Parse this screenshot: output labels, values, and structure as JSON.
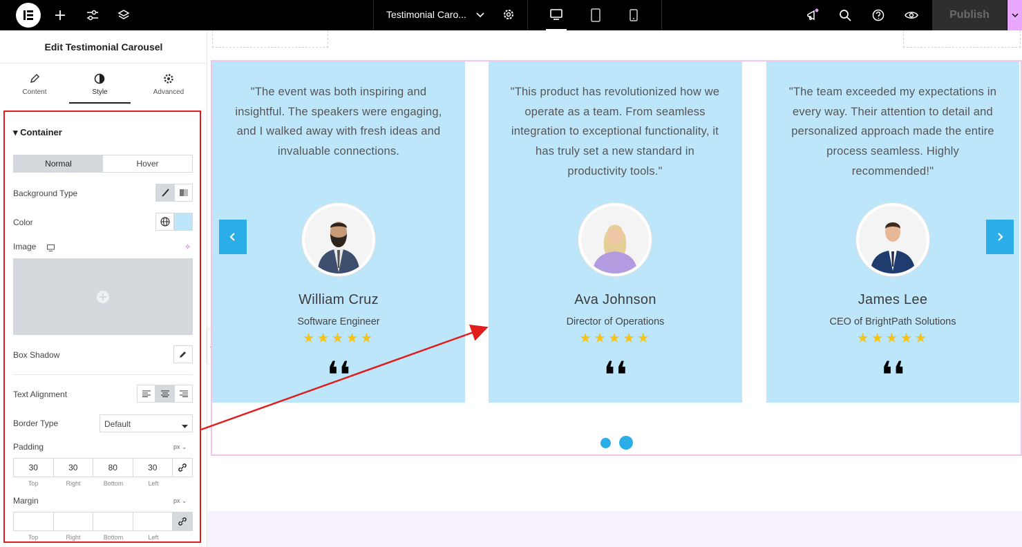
{
  "topbar": {
    "document_title": "Testimonial Caro...",
    "publish_label": "Publish",
    "icons": [
      "elementor-logo-icon",
      "add-icon",
      "settings-sliders-icon",
      "layers-icon",
      "chevron-down-icon",
      "gear-icon",
      "desktop-icon",
      "tablet-icon",
      "mobile-icon",
      "announcement-icon",
      "search-icon",
      "help-icon",
      "preview-eye-icon",
      "caret-down-icon"
    ]
  },
  "panel": {
    "title": "Edit Testimonial Carousel",
    "tabs": [
      {
        "label": "Content",
        "icon": "pencil-icon"
      },
      {
        "label": "Style",
        "icon": "half-circle-icon"
      },
      {
        "label": "Advanced",
        "icon": "gear-icon"
      }
    ],
    "active_tab": "Style",
    "section_title": "Container",
    "state_tabs": [
      "Normal",
      "Hover"
    ],
    "active_state": "Normal",
    "background_type_label": "Background Type",
    "color_label": "Color",
    "image_label": "Image",
    "box_shadow_label": "Box Shadow",
    "text_alignment_label": "Text Alignment",
    "border_type_label": "Border Type",
    "border_type_value": "Default",
    "padding": {
      "label": "Padding",
      "unit": "px",
      "values": [
        "30",
        "30",
        "80",
        "30"
      ],
      "sides": [
        "Top",
        "Right",
        "Bottom",
        "Left"
      ]
    },
    "margin": {
      "label": "Margin",
      "unit": "px",
      "values": [
        "",
        "",
        "",
        ""
      ],
      "sides": [
        "Top",
        "Right",
        "Bottom",
        "Left"
      ]
    },
    "highlight_color": "#e01c1c"
  },
  "testimonials": [
    {
      "quote": "\"The event was both inspiring and insightful. The speakers were engaging, and I walked away with fresh ideas and invaluable connections.",
      "name": "William Cruz",
      "role": "Software Engineer",
      "stars": "★★★★★",
      "quote_mark": "❛❛"
    },
    {
      "quote": "\"This product has revolutionized how we operate as a team. From seamless integration to exceptional functionality, it has truly set a new standard in productivity tools.\"",
      "name": "Ava Johnson",
      "role": "Director of Operations",
      "stars": "★★★★★",
      "quote_mark": "❛❛"
    },
    {
      "quote": "\"The team exceeded my expectations in every way. Their attention to detail and personalized approach made the entire process seamless. Highly recommended!\"",
      "name": "James Lee",
      "role": "CEO of BrightPath Solutions",
      "stars": "★★★★★",
      "quote_mark": "❛❛"
    }
  ],
  "carousel": {
    "card_color": "#bde6fb",
    "accent_color": "#2baee8",
    "star_color": "#f5c418",
    "pagination_dots": 2,
    "active_dot": 2
  }
}
